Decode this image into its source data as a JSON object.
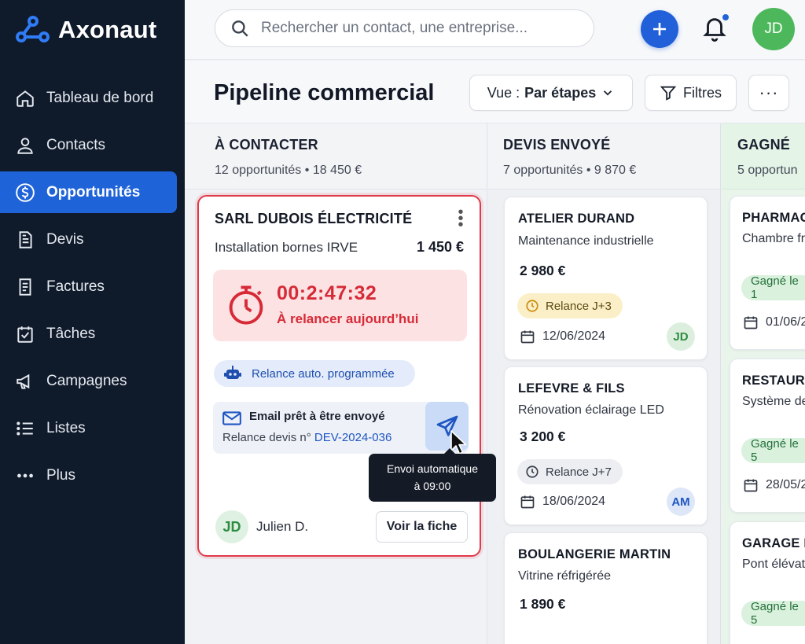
{
  "app": {
    "name": "Axonaut"
  },
  "search": {
    "placeholder": "Rechercher un contact, une entreprise..."
  },
  "user": {
    "initials": "JD"
  },
  "sidebar": {
    "items": [
      {
        "label": "Tableau de bord",
        "icon": "home-icon"
      },
      {
        "label": "Contacts",
        "icon": "user-icon"
      },
      {
        "label": "Opportunités",
        "icon": "dollar-icon",
        "active": true
      },
      {
        "label": "Devis",
        "icon": "document-icon"
      },
      {
        "label": "Factures",
        "icon": "invoice-icon"
      },
      {
        "label": "Tâches",
        "icon": "calendar-check-icon"
      },
      {
        "label": "Campagnes",
        "icon": "megaphone-icon"
      },
      {
        "label": "Listes",
        "icon": "list-icon"
      },
      {
        "label": "Plus",
        "icon": "more-icon"
      }
    ]
  },
  "header": {
    "title": "Pipeline commercial",
    "view_prefix": "Vue :",
    "view_value": "Par étapes",
    "filters": "Filtres",
    "more": "···"
  },
  "columns": [
    {
      "title": "À CONTACTER",
      "count": "12 opportunités",
      "total": "18 450 €"
    },
    {
      "title": "DEVIS ENVOYÉ",
      "count": "7 opportunités",
      "total": "9 870 €"
    },
    {
      "title": "GAGNÉ",
      "count": "5 opportun"
    }
  ],
  "main_card": {
    "company": "SARL DUBOIS ÉLECTRICITÉ",
    "description": "Installation bornes IRVE",
    "amount": "1 450 €",
    "timer": "00:2:47:32",
    "timer_label": "À relancer aujourd’hui",
    "auto_label": "Relance auto. programmée",
    "email_title": "Email prêt à être envoyé",
    "email_ref_prefix": "Relance devis n°",
    "email_ref": "DEV-2024-036",
    "tooltip_line1": "Envoi automatique",
    "tooltip_line2": "à 09:00",
    "owner_initials": "JD",
    "owner_name": "Julien D.",
    "view_button": "Voir la fiche",
    "colors": {
      "border": "#e0394a",
      "timer": "#d62a37"
    }
  },
  "devis_cards": [
    {
      "company": "ATELIER DURAND",
      "description": "Maintenance industrielle",
      "amount": "2 980 €",
      "status": "Relance J+3",
      "status_type": "warning",
      "date": "12/06/2024",
      "owner": "JD"
    },
    {
      "company": "LEFEVRE & FILS",
      "description": "Rénovation éclairage LED",
      "amount": "3 200 €",
      "status": "Relance J+7",
      "status_type": "neutral",
      "date": "18/06/2024",
      "owner": "AM"
    },
    {
      "company": "BOULANGERIE MARTIN",
      "description": "Vitrine réfrigérée",
      "amount": "1 890 €"
    }
  ],
  "won_cards": [
    {
      "company": "PHARMAC",
      "description": "Chambre fr",
      "status": "Gagné le 1",
      "date": "01/06/2"
    },
    {
      "company": "RESTAURE",
      "description": "Système de",
      "status": "Gagné le 5",
      "date": "28/05/2"
    },
    {
      "company": "GARAGE P",
      "description": "Pont élévat",
      "status": "Gagné le 5"
    }
  ]
}
